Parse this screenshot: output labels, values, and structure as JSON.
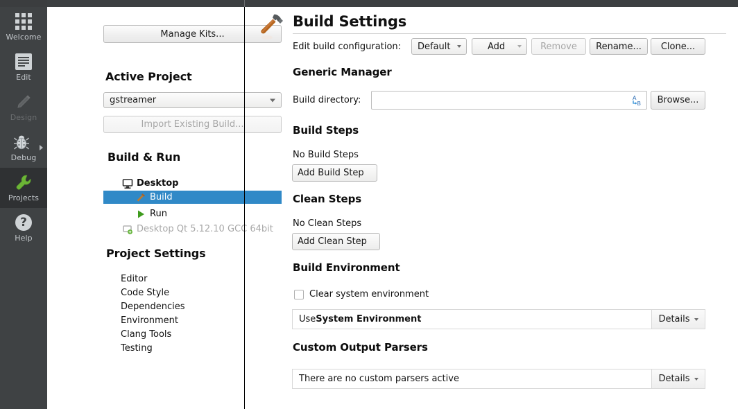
{
  "colors": {
    "selection_blue": "#3089c7",
    "mode_bar_bg": "#3f4244",
    "mode_bar_selected": "#2f3133",
    "top_bar": "#3c3f41",
    "disabled_text": "#a6a6a6"
  },
  "mode_bar": {
    "items": [
      {
        "label": "Welcome",
        "icon": "grid-icon",
        "state": "normal"
      },
      {
        "label": "Edit",
        "icon": "document-icon",
        "state": "normal"
      },
      {
        "label": "Design",
        "icon": "pencil-icon",
        "state": "disabled"
      },
      {
        "label": "Debug",
        "icon": "bug-icon",
        "state": "normal"
      },
      {
        "label": "Projects",
        "icon": "wrench-icon",
        "state": "selected"
      },
      {
        "label": "Help",
        "icon": "question-icon",
        "state": "normal"
      }
    ]
  },
  "project_panel": {
    "manage_kits_label": "Manage Kits...",
    "active_project_heading": "Active Project",
    "project_selected": "gstreamer",
    "import_existing_label": "Import Existing Build...",
    "build_run_heading": "Build & Run",
    "tree": {
      "desktop_label": "Desktop",
      "desktop_icon": "monitor-icon",
      "build_label": "Build",
      "build_icon": "hammer-icon",
      "run_label": "Run",
      "run_icon": "play-icon",
      "kit_label": "Desktop Qt 5.12.10 GCC 64bit",
      "kit_icon": "monitor-add-icon"
    },
    "project_settings_heading": "Project Settings",
    "project_settings_items": [
      "Editor",
      "Code Style",
      "Dependencies",
      "Environment",
      "Clang Tools",
      "Testing"
    ]
  },
  "build_settings": {
    "title": "Build Settings",
    "title_icon": "hammer-icon",
    "edit_build_configuration_label": "Edit build configuration:",
    "configuration_selected": "Default",
    "add_label": "Add",
    "remove_label": "Remove",
    "rename_label": "Rename...",
    "clone_label": "Clone...",
    "generic_manager": {
      "heading": "Generic Manager",
      "build_directory_label": "Build directory:",
      "build_directory_value": "",
      "variable_chooser_icon": "variable-chooser-icon",
      "browse_label": "Browse..."
    },
    "build_steps": {
      "heading": "Build Steps",
      "empty_text": "No Build Steps",
      "add_label": "Add Build Step"
    },
    "clean_steps": {
      "heading": "Clean Steps",
      "empty_text": "No Clean Steps",
      "add_label": "Add Clean Step"
    },
    "build_environment": {
      "heading": "Build Environment",
      "clear_system_environment_label": "Clear system environment",
      "clear_system_environment_checked": false,
      "summary_prefix": "Use ",
      "summary_bold": "System Environment",
      "details_label": "Details"
    },
    "custom_output_parsers": {
      "heading": "Custom Output Parsers",
      "summary": "There are no custom parsers active",
      "details_label": "Details"
    }
  }
}
